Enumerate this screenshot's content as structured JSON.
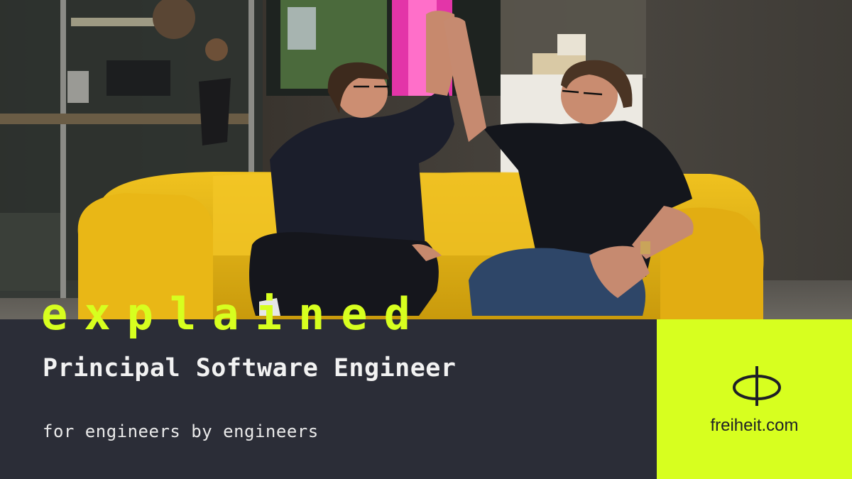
{
  "banner": {
    "headline": "explained",
    "title": "Principal Software Engineer",
    "tagline": "for engineers by engineers"
  },
  "brand": {
    "name": "freiheit.com",
    "icon": "freiheit-logo-icon"
  },
  "colors": {
    "accent": "#d7ff1f",
    "banner_bg": "#2b2d37",
    "title_text": "#f2f2f2",
    "logo_text": "#1e1f26",
    "sofa": "#e8b514"
  }
}
